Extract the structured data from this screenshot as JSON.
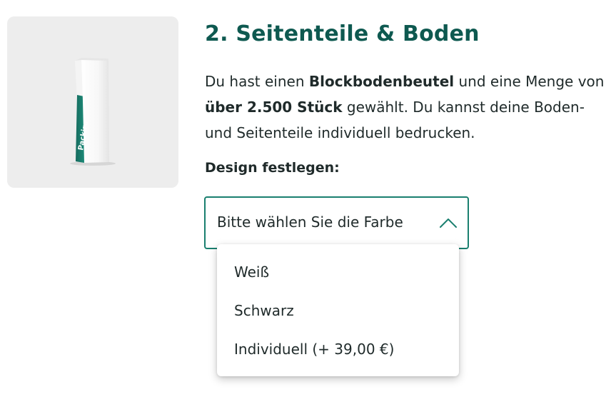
{
  "section": {
    "title": "2. Seitenteile & Boden",
    "description": {
      "part1": "Du hast einen ",
      "bold1": "Blockbodenbeutel",
      "part2": " und eine Menge von ",
      "bold2": "über 2.500 Stück",
      "part3": " gewählt. Du kannst deine Boden- und Seitenteile individuell bedrucken."
    },
    "design_label": "Design festlegen:"
  },
  "product_image": {
    "brand_text": "Packiro",
    "accent_color": "#1a7f6f"
  },
  "select": {
    "placeholder": "Bitte wählen Sie die Farbe",
    "state": "open",
    "border_color": "#1a7f6f",
    "icon": "chevron-up-icon"
  },
  "dropdown": {
    "options": [
      {
        "label": "Weiß"
      },
      {
        "label": "Schwarz"
      },
      {
        "label": "Individuell (+ 39,00 €)"
      }
    ]
  },
  "colors": {
    "title": "#0e5950",
    "text": "#1f2a2a",
    "card_background": "#ededed"
  }
}
